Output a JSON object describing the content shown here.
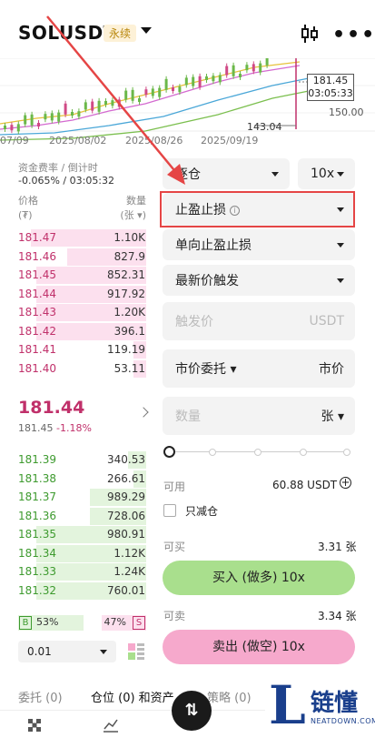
{
  "header": {
    "pair": "SOLUSDT",
    "badge": "永续",
    "candle_icon": "candlestick-icon",
    "more_icon": "more-icon",
    "more": "•••"
  },
  "chart": {
    "dates": [
      "07/09",
      "2025/08/02",
      "2025/08/26",
      "2025/09/19"
    ],
    "price_tag_1": "181.45",
    "price_tag_2": "03:05:33",
    "low_label": "143.04",
    "axis_label": "150.00"
  },
  "funding": {
    "label": "资金费率 / 倒计时",
    "value": "-0.065% / 03:05:32"
  },
  "orderbook": {
    "price_header": "价格",
    "price_unit": "(₮)",
    "qty_header": "数量",
    "qty_unit": "(张 ▾)",
    "asks": [
      {
        "price": "181.47",
        "qty": "1.10K",
        "fill": 0.9
      },
      {
        "price": "181.46",
        "qty": "827.9",
        "fill": 0.62
      },
      {
        "price": "181.45",
        "qty": "852.31",
        "fill": 0.86
      },
      {
        "price": "181.44",
        "qty": "917.92",
        "fill": 0.86
      },
      {
        "price": "181.43",
        "qty": "1.20K",
        "fill": 0.86
      },
      {
        "price": "181.42",
        "qty": "396.1",
        "fill": 0.86
      },
      {
        "price": "181.41",
        "qty": "119.19",
        "fill": 0.1
      },
      {
        "price": "181.40",
        "qty": "53.11",
        "fill": 0.1
      }
    ],
    "last_price": "181.44",
    "mark_price": "181.45",
    "change": "-1.18%",
    "bids": [
      {
        "price": "181.39",
        "qty": "340.53",
        "fill": 0.14
      },
      {
        "price": "181.38",
        "qty": "266.61",
        "fill": 0.1
      },
      {
        "price": "181.37",
        "qty": "989.29",
        "fill": 0.44
      },
      {
        "price": "181.36",
        "qty": "728.06",
        "fill": 0.44
      },
      {
        "price": "181.35",
        "qty": "980.91",
        "fill": 0.86
      },
      {
        "price": "181.34",
        "qty": "1.12K",
        "fill": 0.86
      },
      {
        "price": "181.33",
        "qty": "1.24K",
        "fill": 0.86
      },
      {
        "price": "181.32",
        "qty": "760.01",
        "fill": 0.86
      }
    ],
    "buy_tag": "B",
    "buy_ratio": "53%",
    "sell_ratio": "47%",
    "sell_tag": "S",
    "precision": "0.01"
  },
  "form": {
    "margin_mode": "逐仓",
    "leverage": "10x",
    "order_type": "止盈止损",
    "tpsl_mode": "单向止盈止损",
    "trigger_type": "最新价触发",
    "trigger_placeholder": "触发价",
    "trigger_unit": "USDT",
    "exec_type": "市价委托",
    "exec_value": "市价",
    "qty_placeholder": "数量",
    "qty_unit": "张",
    "available_label": "可用",
    "available_value": "60.88 USDT",
    "reduce_only": "只减仓",
    "can_buy_label": "可买",
    "can_buy_value": "3.31 张",
    "buy_button": "买入 (做多) 10x",
    "can_sell_label": "可卖",
    "can_sell_value": "3.34 张",
    "sell_button": "卖出 (做空) 10x"
  },
  "tabs": {
    "orders": "委托 (0)",
    "positions": "仓位 (0) 和资产",
    "strategy": "策略 (0)"
  },
  "watermark": {
    "letter": "L",
    "cn": "链懂",
    "en": "NEATDOWN.COM"
  },
  "colors": {
    "ask": "#c0306a",
    "bid": "#3d9a2e",
    "buy_btn": "#a9df8d",
    "sell_btn": "#f6a9cc",
    "annotation": "#e54545"
  }
}
